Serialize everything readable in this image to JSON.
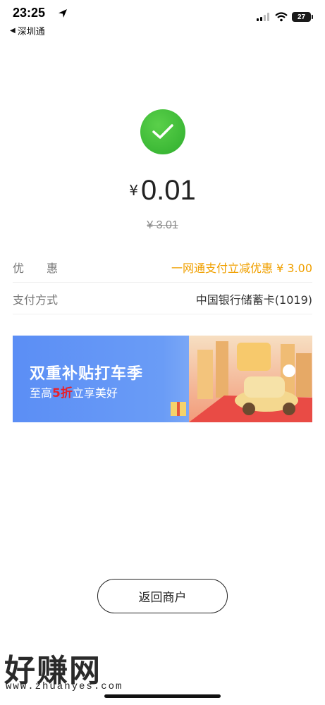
{
  "status_bar": {
    "time": "23:25",
    "back_app": "深圳通",
    "battery": "27"
  },
  "payment": {
    "amount_currency": "¥",
    "amount": "0.01",
    "original_price": "¥ 3.01",
    "rows": [
      {
        "label": "优　　惠",
        "value": "一网通支付立减优惠 ¥ 3.00"
      },
      {
        "label": "支付方式",
        "value": "中国银行储蓄卡(1019)"
      }
    ]
  },
  "banner": {
    "title": "双重补贴打车季",
    "sub_prefix": "至高",
    "sub_highlight": "5折",
    "sub_suffix": "立享美好"
  },
  "return_button": "返回商户",
  "watermark": {
    "logo": "好赚网",
    "url": "www.zhuanyes.com"
  },
  "colors": {
    "success": "#2fae2d",
    "discount": "#f0a000",
    "banner_blue": "#5b8ef5",
    "highlight_red": "#e8202a"
  }
}
